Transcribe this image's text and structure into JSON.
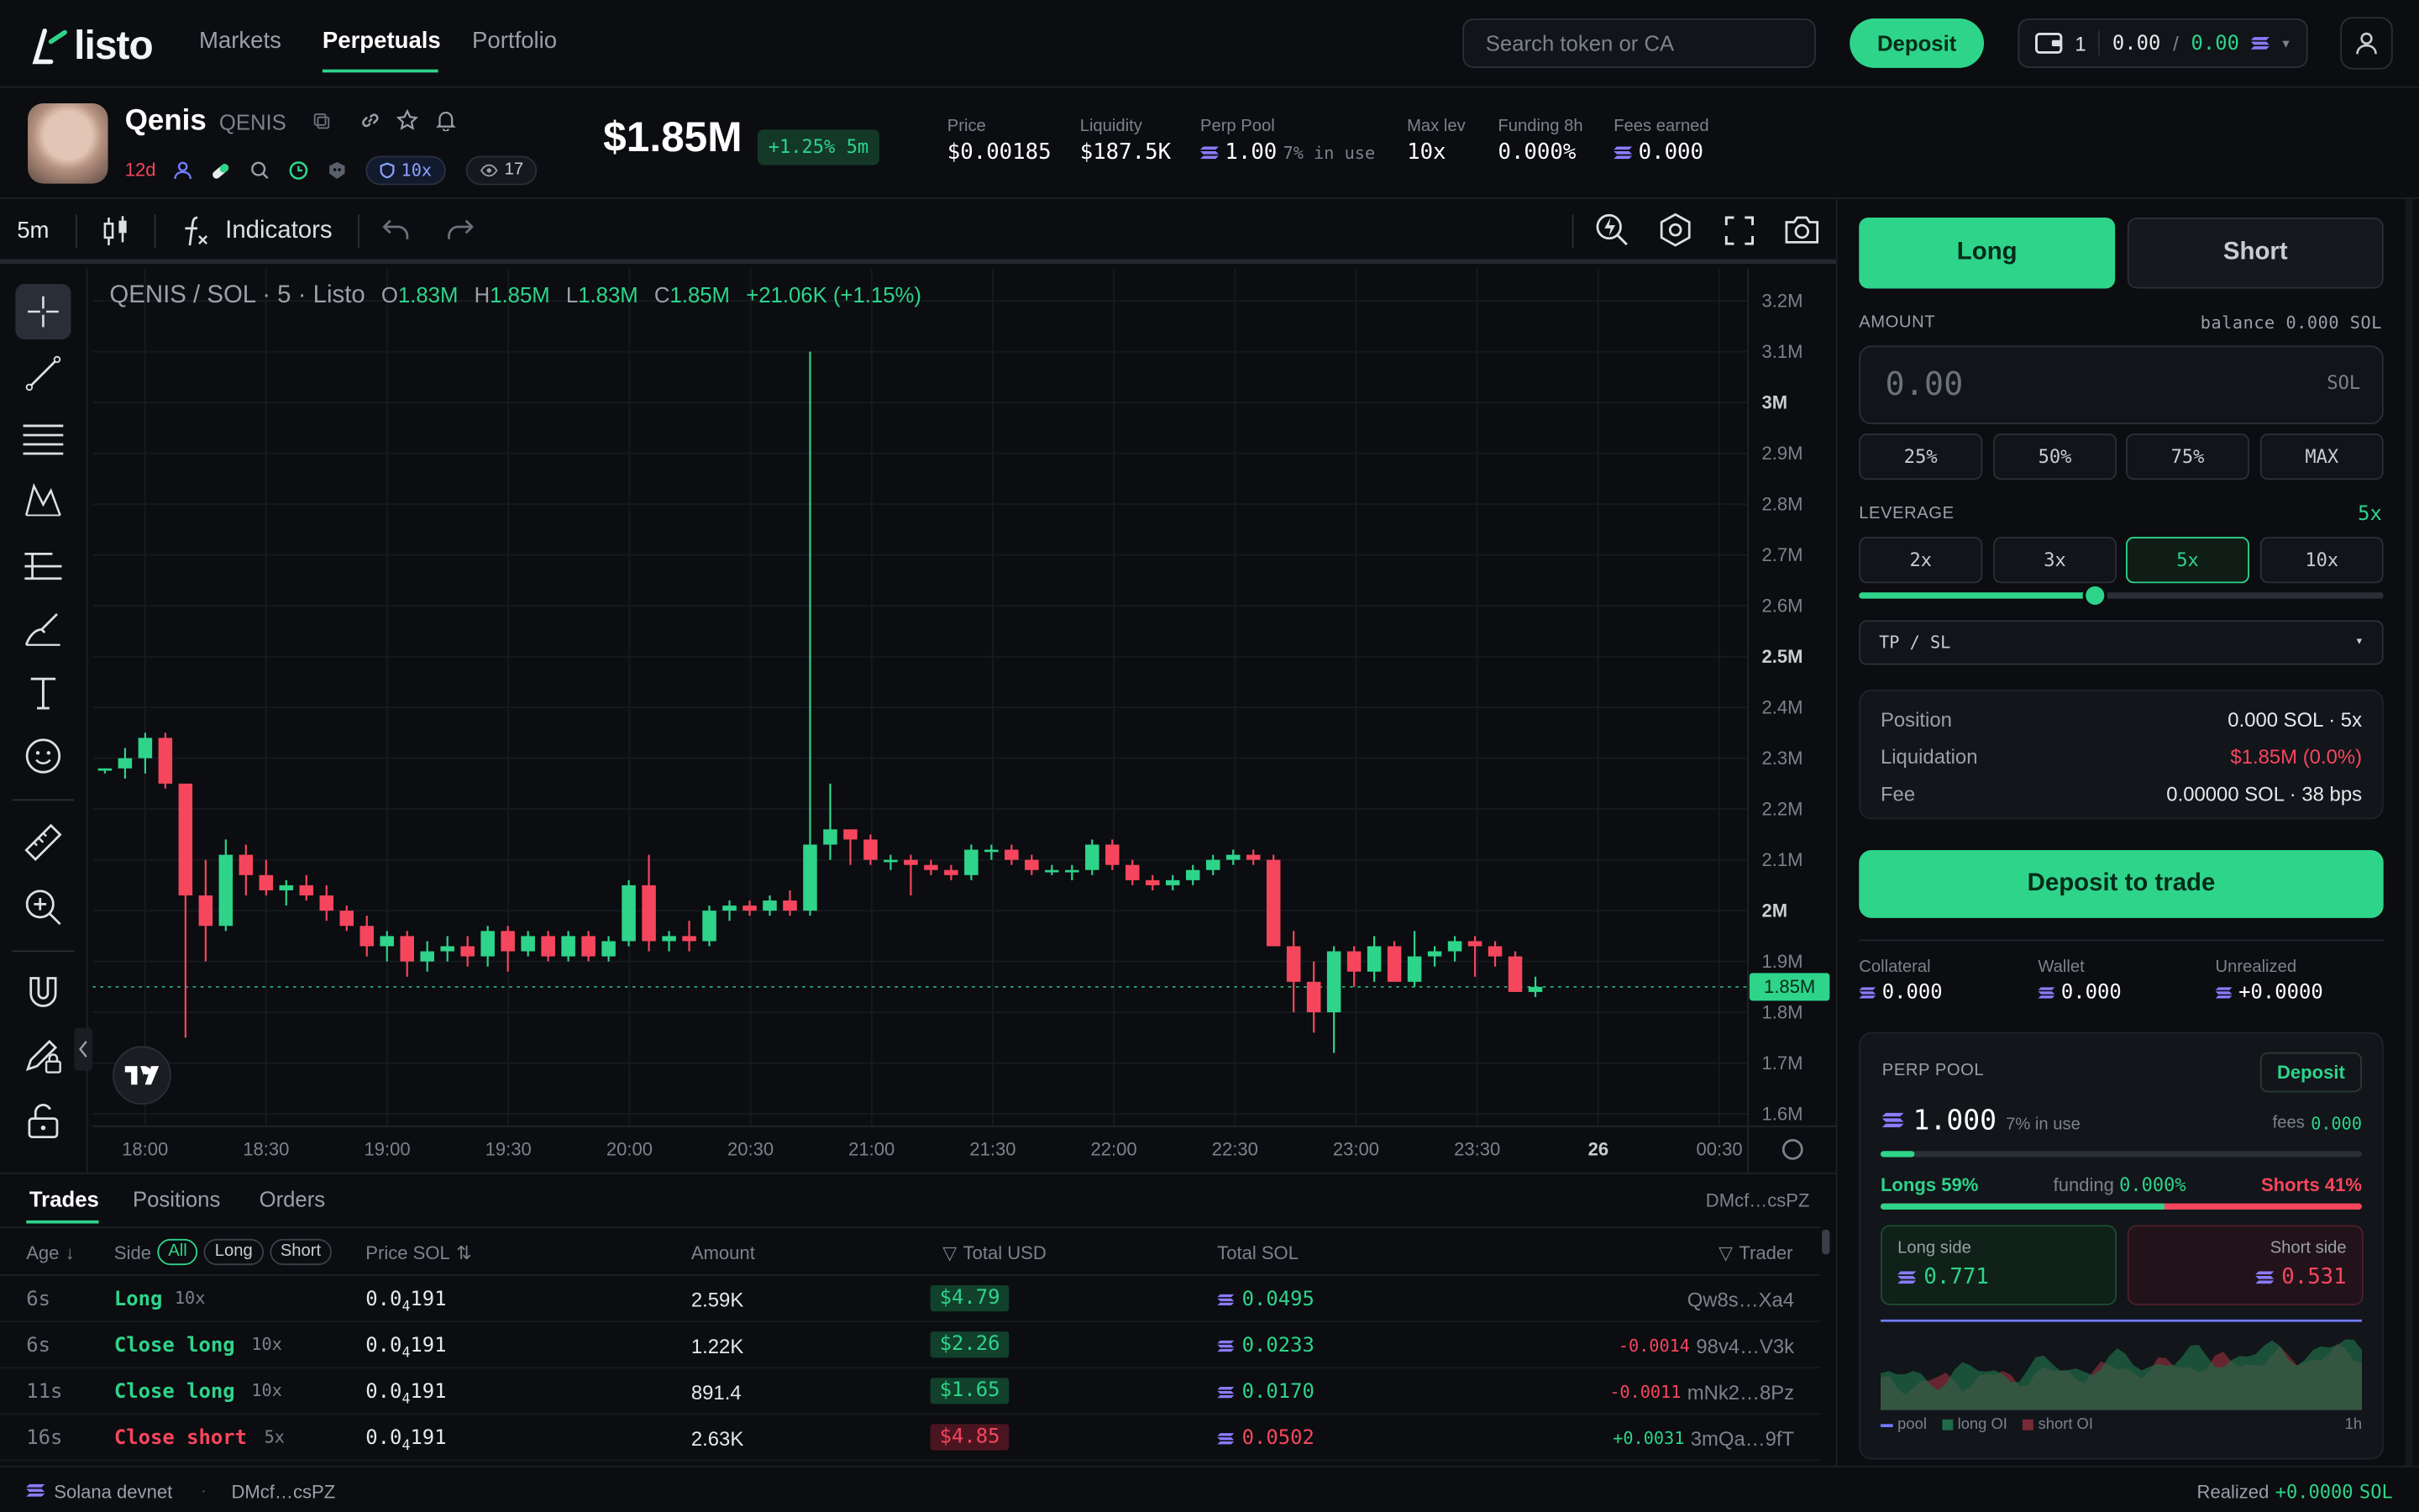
{
  "header": {
    "logo_text": "listo",
    "nav": [
      "Markets",
      "Perpetuals",
      "Portfolio"
    ],
    "search_placeholder": "Search token or CA",
    "deposit_label": "Deposit",
    "wallet": {
      "count": "1",
      "balance": "0.00",
      "sep": "/",
      "balance2": "0.00"
    }
  },
  "token": {
    "name": "Qenis",
    "ticker": "QENIS",
    "age": "12d",
    "leverage_badge": "10x",
    "watchers": "17",
    "market_cap": "$1.85M",
    "change": "+1.25% 5m",
    "stats": [
      {
        "label": "Price",
        "value": "$0.00185"
      },
      {
        "label": "Liquidity",
        "value": "$187.5K"
      },
      {
        "label": "Perp Pool",
        "value": "1.00",
        "extra": "7% in use"
      },
      {
        "label": "Max lev",
        "value": "10x"
      },
      {
        "label": "Funding 8h",
        "value": "0.000%"
      },
      {
        "label": "Fees earned",
        "value": "0.000"
      }
    ]
  },
  "chart_toolbar": {
    "interval": "5m",
    "indicators": "Indicators"
  },
  "chart_legend": {
    "pair": "QENIS / SOL · 5 · Listo",
    "o_label": "O",
    "o": "1.83M",
    "h_label": "H",
    "h": "1.85M",
    "l_label": "L",
    "l": "1.83M",
    "c_label": "C",
    "c": "1.85M",
    "change": "+21.06K (+1.15%)"
  },
  "chart_data": {
    "type": "candlestick",
    "y_ticks": [
      "3.2M",
      "3.1M",
      "3M",
      "2.9M",
      "2.8M",
      "2.7M",
      "2.6M",
      "2.5M",
      "2.4M",
      "2.3M",
      "2.2M",
      "2.1M",
      "2M",
      "1.9M",
      "1.8M",
      "1.7M",
      "1.6M"
    ],
    "y_range": [
      1.6,
      3.2
    ],
    "y_unit": "M",
    "x_ticks": [
      "18:00",
      "18:30",
      "19:00",
      "19:30",
      "20:00",
      "20:30",
      "21:00",
      "21:30",
      "22:00",
      "22:30",
      "23:00",
      "23:30",
      "26",
      "00:30"
    ],
    "current_price_label": "1.85M",
    "current_price": 1.85,
    "candles": [
      [
        2.28,
        2.28,
        2.27,
        2.28
      ],
      [
        2.28,
        2.32,
        2.26,
        2.3
      ],
      [
        2.3,
        2.35,
        2.27,
        2.34
      ],
      [
        2.34,
        2.35,
        2.24,
        2.25
      ],
      [
        2.25,
        2.25,
        1.75,
        2.03
      ],
      [
        2.03,
        2.1,
        1.9,
        1.97
      ],
      [
        1.97,
        2.14,
        1.96,
        2.11
      ],
      [
        2.11,
        2.13,
        2.03,
        2.07
      ],
      [
        2.07,
        2.1,
        2.03,
        2.04
      ],
      [
        2.04,
        2.06,
        2.01,
        2.05
      ],
      [
        2.05,
        2.07,
        2.02,
        2.03
      ],
      [
        2.03,
        2.05,
        1.98,
        2.0
      ],
      [
        2.0,
        2.01,
        1.96,
        1.97
      ],
      [
        1.97,
        1.99,
        1.91,
        1.93
      ],
      [
        1.93,
        1.96,
        1.9,
        1.95
      ],
      [
        1.95,
        1.96,
        1.87,
        1.9
      ],
      [
        1.9,
        1.94,
        1.88,
        1.92
      ],
      [
        1.92,
        1.95,
        1.9,
        1.93
      ],
      [
        1.93,
        1.95,
        1.89,
        1.91
      ],
      [
        1.91,
        1.97,
        1.89,
        1.96
      ],
      [
        1.96,
        1.97,
        1.88,
        1.92
      ],
      [
        1.92,
        1.96,
        1.91,
        1.95
      ],
      [
        1.95,
        1.96,
        1.9,
        1.91
      ],
      [
        1.91,
        1.96,
        1.9,
        1.95
      ],
      [
        1.95,
        1.96,
        1.9,
        1.91
      ],
      [
        1.91,
        1.95,
        1.9,
        1.94
      ],
      [
        1.94,
        2.06,
        1.93,
        2.05
      ],
      [
        2.05,
        2.11,
        1.92,
        1.94
      ],
      [
        1.94,
        1.96,
        1.92,
        1.95
      ],
      [
        1.95,
        1.98,
        1.92,
        1.94
      ],
      [
        1.94,
        2.01,
        1.93,
        2.0
      ],
      [
        2.0,
        2.02,
        1.98,
        2.01
      ],
      [
        2.01,
        2.02,
        1.99,
        2.0
      ],
      [
        2.0,
        2.03,
        1.99,
        2.02
      ],
      [
        2.02,
        2.04,
        1.99,
        2.0
      ],
      [
        2.0,
        3.1,
        1.99,
        2.13
      ],
      [
        2.13,
        2.25,
        2.1,
        2.16
      ],
      [
        2.16,
        2.16,
        2.09,
        2.14
      ],
      [
        2.14,
        2.15,
        2.09,
        2.1
      ],
      [
        2.1,
        2.11,
        2.08,
        2.1
      ],
      [
        2.1,
        2.11,
        2.03,
        2.09
      ],
      [
        2.09,
        2.1,
        2.07,
        2.08
      ],
      [
        2.08,
        2.09,
        2.06,
        2.07
      ],
      [
        2.07,
        2.13,
        2.06,
        2.12
      ],
      [
        2.12,
        2.13,
        2.1,
        2.12
      ],
      [
        2.12,
        2.13,
        2.09,
        2.1
      ],
      [
        2.1,
        2.11,
        2.07,
        2.08
      ],
      [
        2.08,
        2.09,
        2.07,
        2.08
      ],
      [
        2.08,
        2.09,
        2.06,
        2.08
      ],
      [
        2.08,
        2.14,
        2.07,
        2.13
      ],
      [
        2.13,
        2.14,
        2.08,
        2.09
      ],
      [
        2.09,
        2.1,
        2.05,
        2.06
      ],
      [
        2.06,
        2.07,
        2.04,
        2.05
      ],
      [
        2.05,
        2.07,
        2.04,
        2.06
      ],
      [
        2.06,
        2.09,
        2.05,
        2.08
      ],
      [
        2.08,
        2.11,
        2.07,
        2.1
      ],
      [
        2.1,
        2.12,
        2.09,
        2.11
      ],
      [
        2.11,
        2.12,
        2.09,
        2.1
      ],
      [
        2.1,
        2.11,
        1.98,
        1.93
      ],
      [
        1.93,
        1.96,
        1.8,
        1.86
      ],
      [
        1.86,
        1.9,
        1.76,
        1.8
      ],
      [
        1.8,
        1.93,
        1.72,
        1.92
      ],
      [
        1.92,
        1.93,
        1.85,
        1.88
      ],
      [
        1.88,
        1.95,
        1.86,
        1.93
      ],
      [
        1.93,
        1.94,
        1.86,
        1.86
      ],
      [
        1.86,
        1.96,
        1.85,
        1.91
      ],
      [
        1.91,
        1.93,
        1.89,
        1.92
      ],
      [
        1.92,
        1.95,
        1.9,
        1.94
      ],
      [
        1.94,
        1.95,
        1.87,
        1.93
      ],
      [
        1.93,
        1.94,
        1.89,
        1.91
      ],
      [
        1.91,
        1.92,
        1.84,
        1.84
      ],
      [
        1.84,
        1.87,
        1.83,
        1.85
      ]
    ]
  },
  "bottom": {
    "tabs": [
      "Trades",
      "Positions",
      "Orders"
    ],
    "address": "DMcf…csPZ",
    "columns": {
      "age": "Age",
      "side": "Side",
      "price": "Price SOL",
      "amount": "Amount",
      "total_usd": "Total USD",
      "total_sol": "Total SOL",
      "trader": "Trader"
    },
    "filters": [
      "All",
      "Long",
      "Short"
    ],
    "rows": [
      {
        "age": "6s",
        "side": "Long",
        "lev": "10x",
        "price_pre": "0.0",
        "price_sub": "4",
        "price_post": "191",
        "amount": "2.59K",
        "usd": "$4.79",
        "sol": "0.0495",
        "pnl": "",
        "trader": "Qw8s…Xa4",
        "tone": "g"
      },
      {
        "age": "6s",
        "side": "Close long",
        "lev": "10x",
        "price_pre": "0.0",
        "price_sub": "4",
        "price_post": "191",
        "amount": "1.22K",
        "usd": "$2.26",
        "sol": "0.0233",
        "pnl": "-0.0014",
        "trader": "98v4…V3k",
        "tone": "g"
      },
      {
        "age": "11s",
        "side": "Close long",
        "lev": "10x",
        "price_pre": "0.0",
        "price_sub": "4",
        "price_post": "191",
        "amount": "891.4",
        "usd": "$1.65",
        "sol": "0.0170",
        "pnl": "-0.0011",
        "trader": "mNk2…8Pz",
        "tone": "g"
      },
      {
        "age": "16s",
        "side": "Close short",
        "lev": "5x",
        "price_pre": "0.0",
        "price_sub": "4",
        "price_post": "191",
        "amount": "2.63K",
        "usd": "$4.85",
        "sol": "0.0502",
        "pnl": "+0.0031",
        "trader": "3mQa…9fT",
        "tone": "r"
      }
    ]
  },
  "footer": {
    "network": "Solana devnet",
    "address": "DMcf…csPZ",
    "realized_label": "Realized",
    "realized_value": "+0.0000",
    "realized_unit": "SOL"
  },
  "panel": {
    "long": "Long",
    "short": "Short",
    "amount_label": "AMOUNT",
    "balance": "balance 0.000 SOL",
    "amount_placeholder": "0.00",
    "amount_unit": "SOL",
    "quick": [
      "25%",
      "50%",
      "75%",
      "MAX"
    ],
    "leverage_label": "LEVERAGE",
    "leverage_value": "5x",
    "leverage_options": [
      "2x",
      "3x",
      "5x",
      "10x"
    ],
    "leverage_selected": "5x",
    "leverage_fraction": 0.45,
    "tpsl": "TP / SL",
    "summary": [
      {
        "label": "Position",
        "value": "0.000 SOL · 5x"
      },
      {
        "label": "Liquidation",
        "value": "$1.85M (0.0%)"
      },
      {
        "label": "Fee",
        "value": "0.00000 SOL · 38 bps"
      }
    ],
    "deposit_to_trade": "Deposit to trade",
    "mini": [
      {
        "label": "Collateral",
        "value": "0.000"
      },
      {
        "label": "Wallet",
        "value": "0.000"
      },
      {
        "label": "Unrealized",
        "value": "+0.0000"
      }
    ],
    "pool": {
      "title": "PERP POOL",
      "deposit": "Deposit",
      "amount": "1.000",
      "in_use": "7% in use",
      "fees_label": "fees",
      "fees_value": "0.000",
      "use_fraction": 0.07,
      "longs": "Longs 59%",
      "funding_label": "funding",
      "funding_value": "0.000%",
      "shorts": "Shorts 41%",
      "long_fraction": 0.59,
      "long_side_label": "Long side",
      "long_side_value": "0.771",
      "short_side_label": "Short side",
      "short_side_value": "0.531",
      "legend": [
        "pool",
        "long OI",
        "short OI"
      ],
      "timeframe": "1h"
    }
  },
  "colors": {
    "green": "#2ed48a",
    "red": "#f6465d",
    "bg": "#0b0d10"
  }
}
